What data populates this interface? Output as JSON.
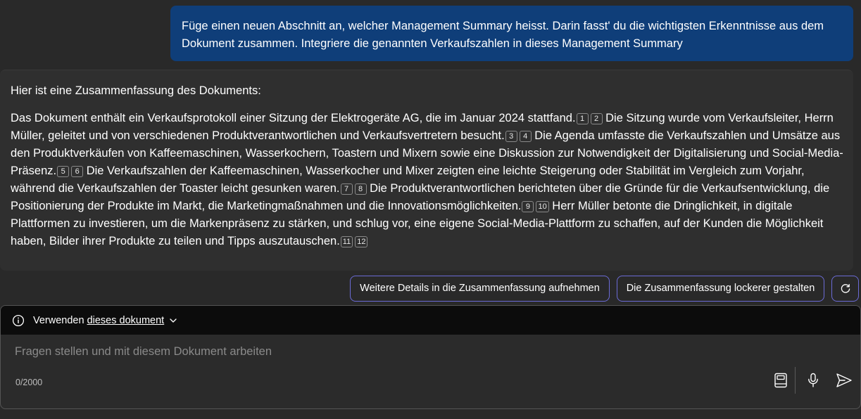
{
  "user_message": "Füge einen neuen Abschnitt an, welcher Management Summary heisst. Darin fasst' du die wichtigsten Erkenntnisse aus dem Dokument zusammen. Integriere die genannten Verkaufszahlen in dieses Management Summary",
  "response": {
    "intro": "Hier ist eine Zusammenfassung des Dokuments:",
    "segments": [
      {
        "text": "Das Dokument enthält ein Verkaufsprotokoll einer Sitzung der Elektrogeräte AG, die im Januar 2024 stattfand.",
        "cites": [
          "1",
          "2"
        ]
      },
      {
        "text": " Die Sitzung wurde vom Verkaufsleiter, Herrn Müller, geleitet und von verschiedenen Produktverantwortlichen und Verkaufsvertretern besucht.",
        "cites": [
          "3",
          "4"
        ]
      },
      {
        "text": " Die Agenda umfasste die Verkaufszahlen und Umsätze aus den Produktverkäufen von Kaffeemaschinen, Wasserkochern, Toastern und Mixern sowie eine Diskussion zur Notwendigkeit der Digitalisierung und Social-Media-Präsenz.",
        "cites": [
          "5",
          "6"
        ]
      },
      {
        "text": " Die Verkaufszahlen der Kaffeemaschinen, Wasserkocher und Mixer zeigten eine leichte Steigerung oder Stabilität im Vergleich zum Vorjahr, während die Verkaufszahlen der Toaster leicht gesunken waren.",
        "cites": [
          "7",
          "8"
        ]
      },
      {
        "text": " Die Produktverantwortlichen berichteten über die Gründe für die Verkaufsentwicklung, die Positionierung der Produkte im Markt, die Marketingmaßnahmen und die Innovationsmöglichkeiten.",
        "cites": [
          "9",
          "10"
        ]
      },
      {
        "text": " Herr Müller betonte die Dringlichkeit, in digitale Plattformen zu investieren, um die Markenpräsenz zu stärken, und schlug vor, eine eigene Social-Media-Plattform zu schaffen, auf der Kunden die Möglichkeit haben, Bilder ihrer Produkte zu teilen und Tipps auszutauschen.",
        "cites": [
          "11",
          "12"
        ]
      }
    ]
  },
  "suggestions": {
    "details": "Weitere Details in die Zusammenfassung aufnehmen",
    "casual": "Die Zusammenfassung lockerer gestalten",
    "refresh_icon": "refresh-icon"
  },
  "composer": {
    "context_prefix": "Verwenden",
    "context_link": "dieses dokument",
    "placeholder": "Fragen stellen und mit diesem Dokument arbeiten",
    "value": "",
    "counter": "0/2000",
    "icons": [
      "info-icon",
      "chevron-down-icon",
      "notebook-icon",
      "microphone-icon",
      "send-icon"
    ]
  },
  "colors": {
    "background": "#292929",
    "user_bubble": "#0f3e79",
    "accent_border": "#6b6bd6",
    "context_bar": "#0c0c0c"
  }
}
